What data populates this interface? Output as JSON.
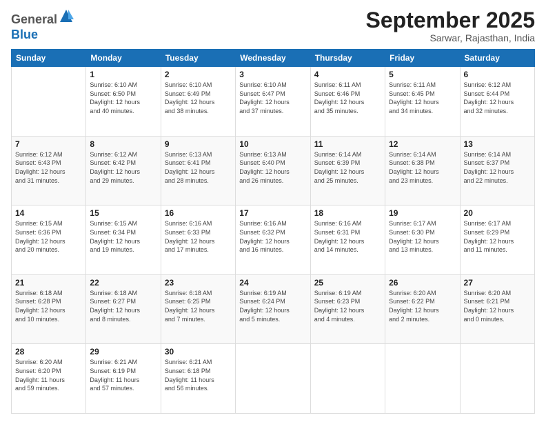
{
  "logo": {
    "line1": "General",
    "line2": "Blue"
  },
  "header": {
    "month": "September 2025",
    "location": "Sarwar, Rajasthan, India"
  },
  "weekdays": [
    "Sunday",
    "Monday",
    "Tuesday",
    "Wednesday",
    "Thursday",
    "Friday",
    "Saturday"
  ],
  "weeks": [
    [
      {
        "day": "",
        "info": ""
      },
      {
        "day": "1",
        "info": "Sunrise: 6:10 AM\nSunset: 6:50 PM\nDaylight: 12 hours\nand 40 minutes."
      },
      {
        "day": "2",
        "info": "Sunrise: 6:10 AM\nSunset: 6:49 PM\nDaylight: 12 hours\nand 38 minutes."
      },
      {
        "day": "3",
        "info": "Sunrise: 6:10 AM\nSunset: 6:47 PM\nDaylight: 12 hours\nand 37 minutes."
      },
      {
        "day": "4",
        "info": "Sunrise: 6:11 AM\nSunset: 6:46 PM\nDaylight: 12 hours\nand 35 minutes."
      },
      {
        "day": "5",
        "info": "Sunrise: 6:11 AM\nSunset: 6:45 PM\nDaylight: 12 hours\nand 34 minutes."
      },
      {
        "day": "6",
        "info": "Sunrise: 6:12 AM\nSunset: 6:44 PM\nDaylight: 12 hours\nand 32 minutes."
      }
    ],
    [
      {
        "day": "7",
        "info": "Sunrise: 6:12 AM\nSunset: 6:43 PM\nDaylight: 12 hours\nand 31 minutes."
      },
      {
        "day": "8",
        "info": "Sunrise: 6:12 AM\nSunset: 6:42 PM\nDaylight: 12 hours\nand 29 minutes."
      },
      {
        "day": "9",
        "info": "Sunrise: 6:13 AM\nSunset: 6:41 PM\nDaylight: 12 hours\nand 28 minutes."
      },
      {
        "day": "10",
        "info": "Sunrise: 6:13 AM\nSunset: 6:40 PM\nDaylight: 12 hours\nand 26 minutes."
      },
      {
        "day": "11",
        "info": "Sunrise: 6:14 AM\nSunset: 6:39 PM\nDaylight: 12 hours\nand 25 minutes."
      },
      {
        "day": "12",
        "info": "Sunrise: 6:14 AM\nSunset: 6:38 PM\nDaylight: 12 hours\nand 23 minutes."
      },
      {
        "day": "13",
        "info": "Sunrise: 6:14 AM\nSunset: 6:37 PM\nDaylight: 12 hours\nand 22 minutes."
      }
    ],
    [
      {
        "day": "14",
        "info": "Sunrise: 6:15 AM\nSunset: 6:36 PM\nDaylight: 12 hours\nand 20 minutes."
      },
      {
        "day": "15",
        "info": "Sunrise: 6:15 AM\nSunset: 6:34 PM\nDaylight: 12 hours\nand 19 minutes."
      },
      {
        "day": "16",
        "info": "Sunrise: 6:16 AM\nSunset: 6:33 PM\nDaylight: 12 hours\nand 17 minutes."
      },
      {
        "day": "17",
        "info": "Sunrise: 6:16 AM\nSunset: 6:32 PM\nDaylight: 12 hours\nand 16 minutes."
      },
      {
        "day": "18",
        "info": "Sunrise: 6:16 AM\nSunset: 6:31 PM\nDaylight: 12 hours\nand 14 minutes."
      },
      {
        "day": "19",
        "info": "Sunrise: 6:17 AM\nSunset: 6:30 PM\nDaylight: 12 hours\nand 13 minutes."
      },
      {
        "day": "20",
        "info": "Sunrise: 6:17 AM\nSunset: 6:29 PM\nDaylight: 12 hours\nand 11 minutes."
      }
    ],
    [
      {
        "day": "21",
        "info": "Sunrise: 6:18 AM\nSunset: 6:28 PM\nDaylight: 12 hours\nand 10 minutes."
      },
      {
        "day": "22",
        "info": "Sunrise: 6:18 AM\nSunset: 6:27 PM\nDaylight: 12 hours\nand 8 minutes."
      },
      {
        "day": "23",
        "info": "Sunrise: 6:18 AM\nSunset: 6:25 PM\nDaylight: 12 hours\nand 7 minutes."
      },
      {
        "day": "24",
        "info": "Sunrise: 6:19 AM\nSunset: 6:24 PM\nDaylight: 12 hours\nand 5 minutes."
      },
      {
        "day": "25",
        "info": "Sunrise: 6:19 AM\nSunset: 6:23 PM\nDaylight: 12 hours\nand 4 minutes."
      },
      {
        "day": "26",
        "info": "Sunrise: 6:20 AM\nSunset: 6:22 PM\nDaylight: 12 hours\nand 2 minutes."
      },
      {
        "day": "27",
        "info": "Sunrise: 6:20 AM\nSunset: 6:21 PM\nDaylight: 12 hours\nand 0 minutes."
      }
    ],
    [
      {
        "day": "28",
        "info": "Sunrise: 6:20 AM\nSunset: 6:20 PM\nDaylight: 11 hours\nand 59 minutes."
      },
      {
        "day": "29",
        "info": "Sunrise: 6:21 AM\nSunset: 6:19 PM\nDaylight: 11 hours\nand 57 minutes."
      },
      {
        "day": "30",
        "info": "Sunrise: 6:21 AM\nSunset: 6:18 PM\nDaylight: 11 hours\nand 56 minutes."
      },
      {
        "day": "",
        "info": ""
      },
      {
        "day": "",
        "info": ""
      },
      {
        "day": "",
        "info": ""
      },
      {
        "day": "",
        "info": ""
      }
    ]
  ]
}
